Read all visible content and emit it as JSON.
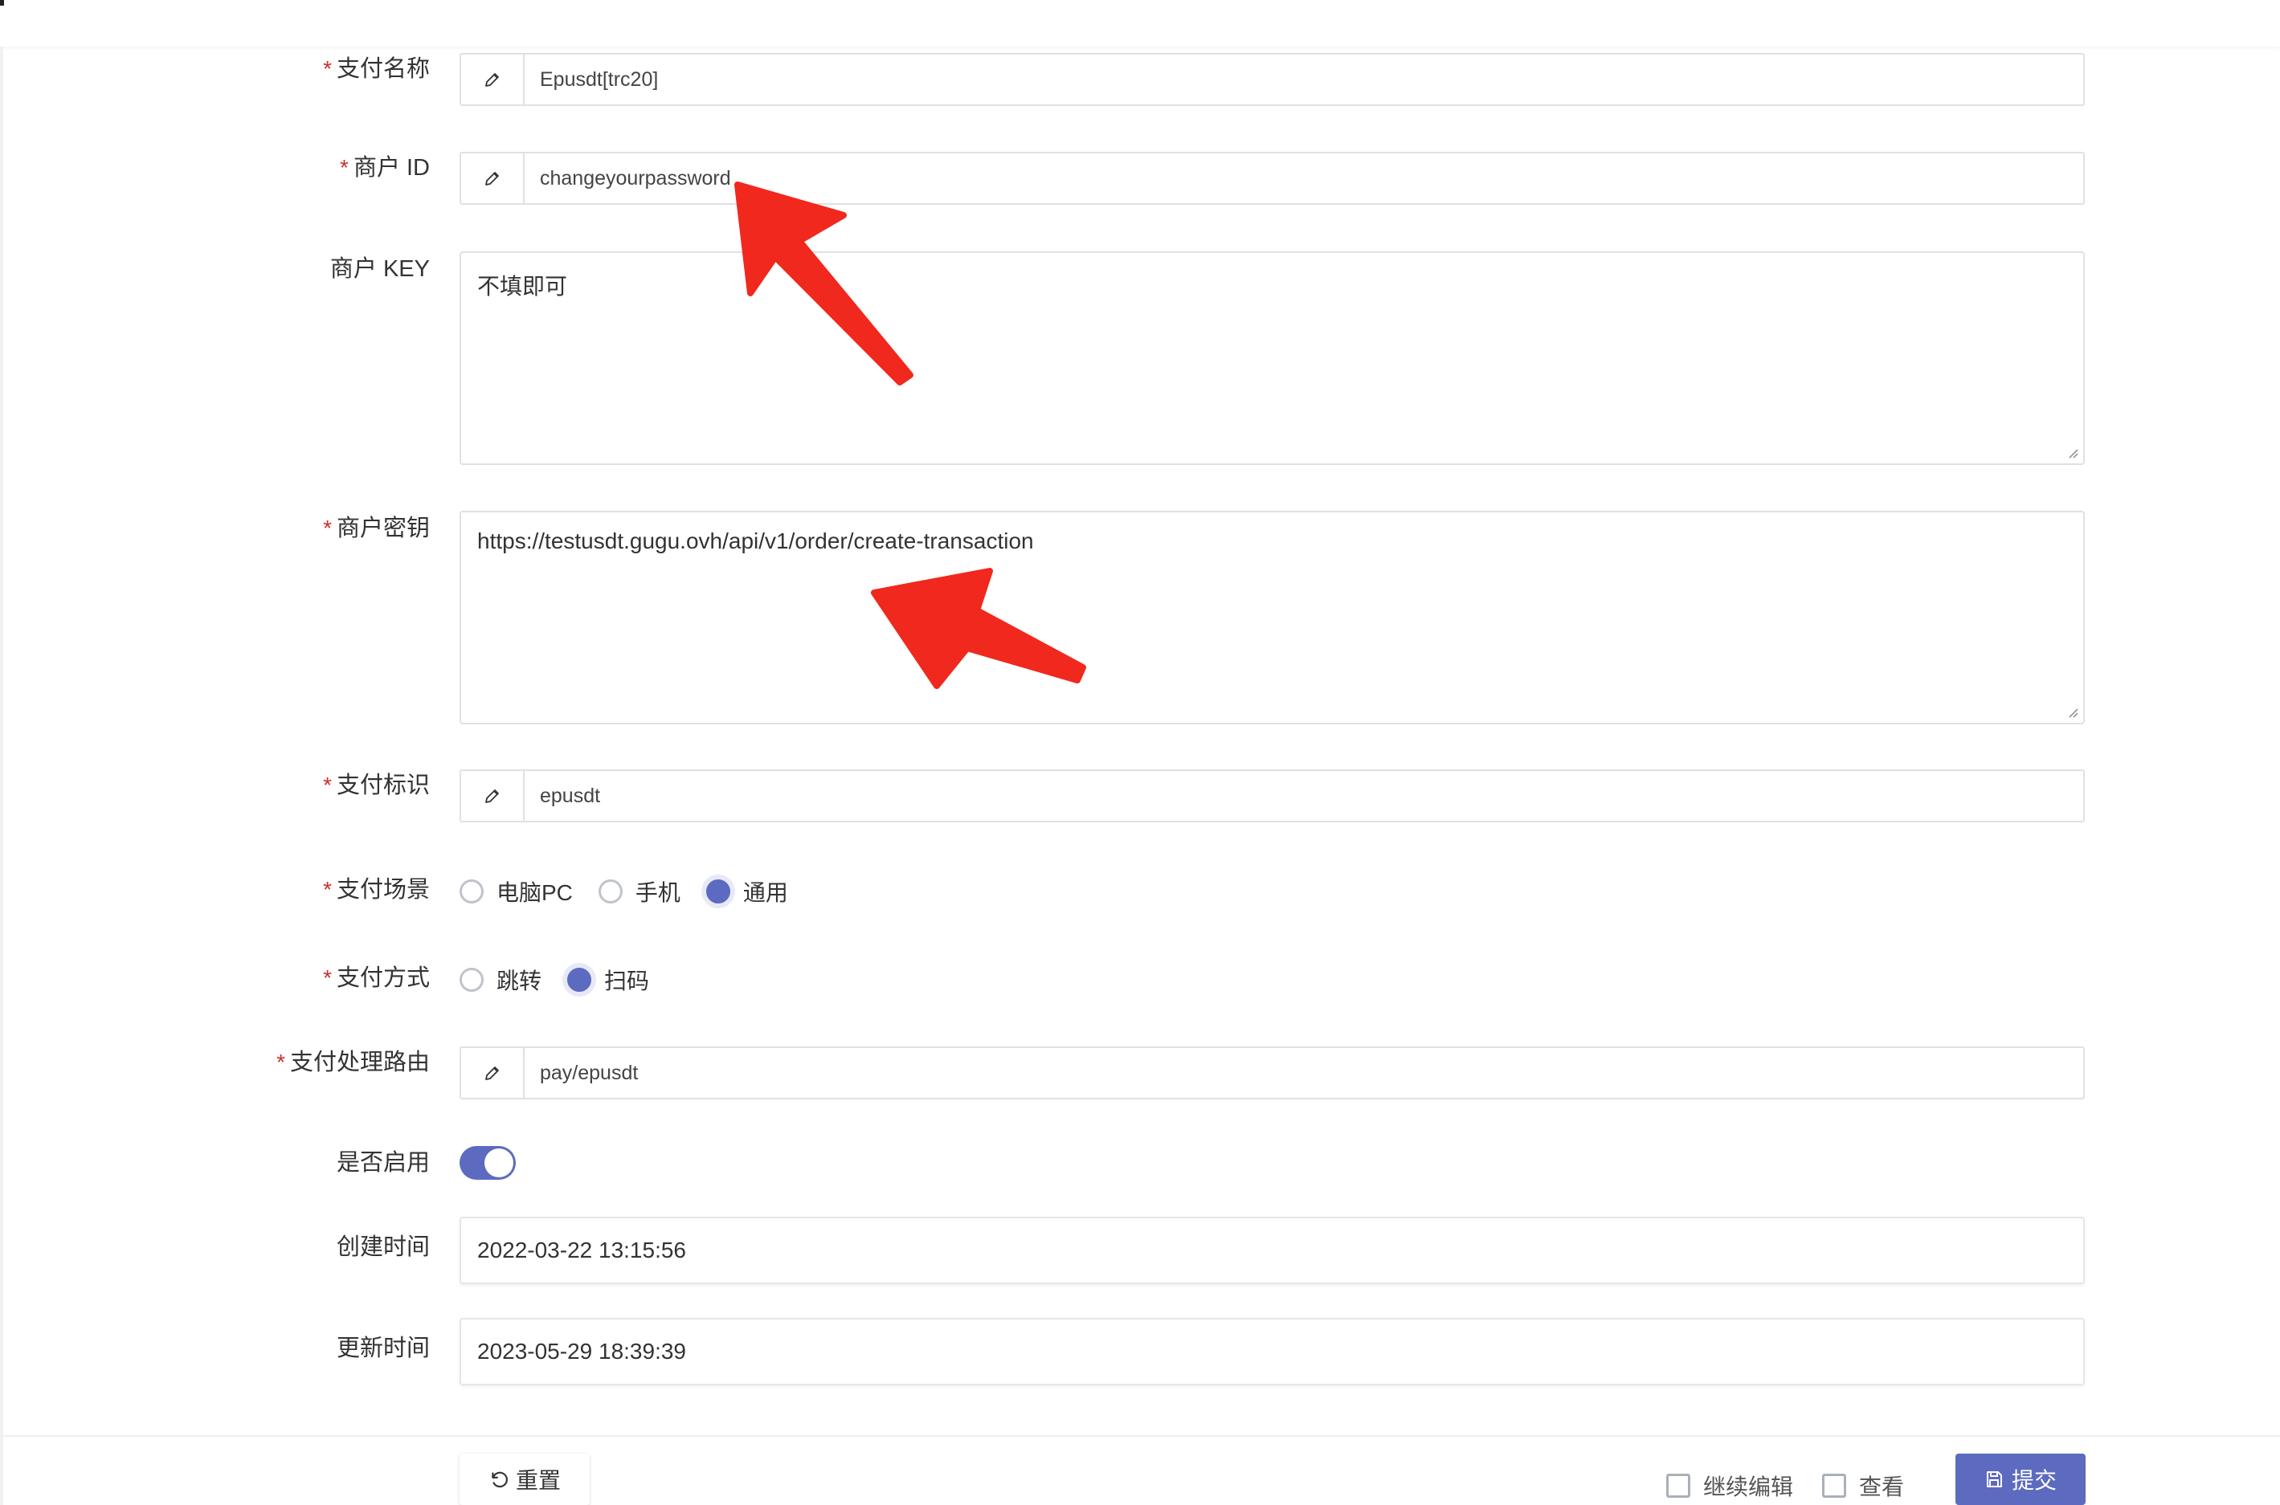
{
  "form": {
    "pay_name": {
      "label": "支付名称",
      "required": true,
      "value": "Epusdt[trc20]"
    },
    "merchant_id": {
      "label": "商户 ID",
      "required": true,
      "value": "changeyourpassword"
    },
    "merchant_key": {
      "label": "商户 KEY",
      "required": false,
      "value": "不填即可"
    },
    "merchant_secret": {
      "label": "商户密钥",
      "required": true,
      "value": "https://testusdt.gugu.ovh/api/v1/order/create-transaction"
    },
    "pay_tag": {
      "label": "支付标识",
      "required": true,
      "value": "epusdt"
    },
    "pay_scene": {
      "label": "支付场景",
      "required": true,
      "options": [
        "电脑PC",
        "手机",
        "通用"
      ],
      "selected": "通用"
    },
    "pay_method": {
      "label": "支付方式",
      "required": true,
      "options": [
        "跳转",
        "扫码"
      ],
      "selected": "扫码"
    },
    "pay_route": {
      "label": "支付处理路由",
      "required": true,
      "value": "pay/epusdt"
    },
    "enabled": {
      "label": "是否启用",
      "value": true
    },
    "created_at": {
      "label": "创建时间",
      "value": "2022-03-22 13:15:56"
    },
    "updated_at": {
      "label": "更新时间",
      "value": "2023-05-29 18:39:39"
    }
  },
  "footer": {
    "reset_label": "重置",
    "continue_edit_label": "继续编辑",
    "view_label": "查看",
    "submit_label": "提交"
  },
  "colors": {
    "primary": "#5c6bc0",
    "required": "#c9302c",
    "annotation_arrow": "#f1281d"
  },
  "icons": [
    "pencil-icon",
    "undo-icon",
    "save-icon"
  ]
}
